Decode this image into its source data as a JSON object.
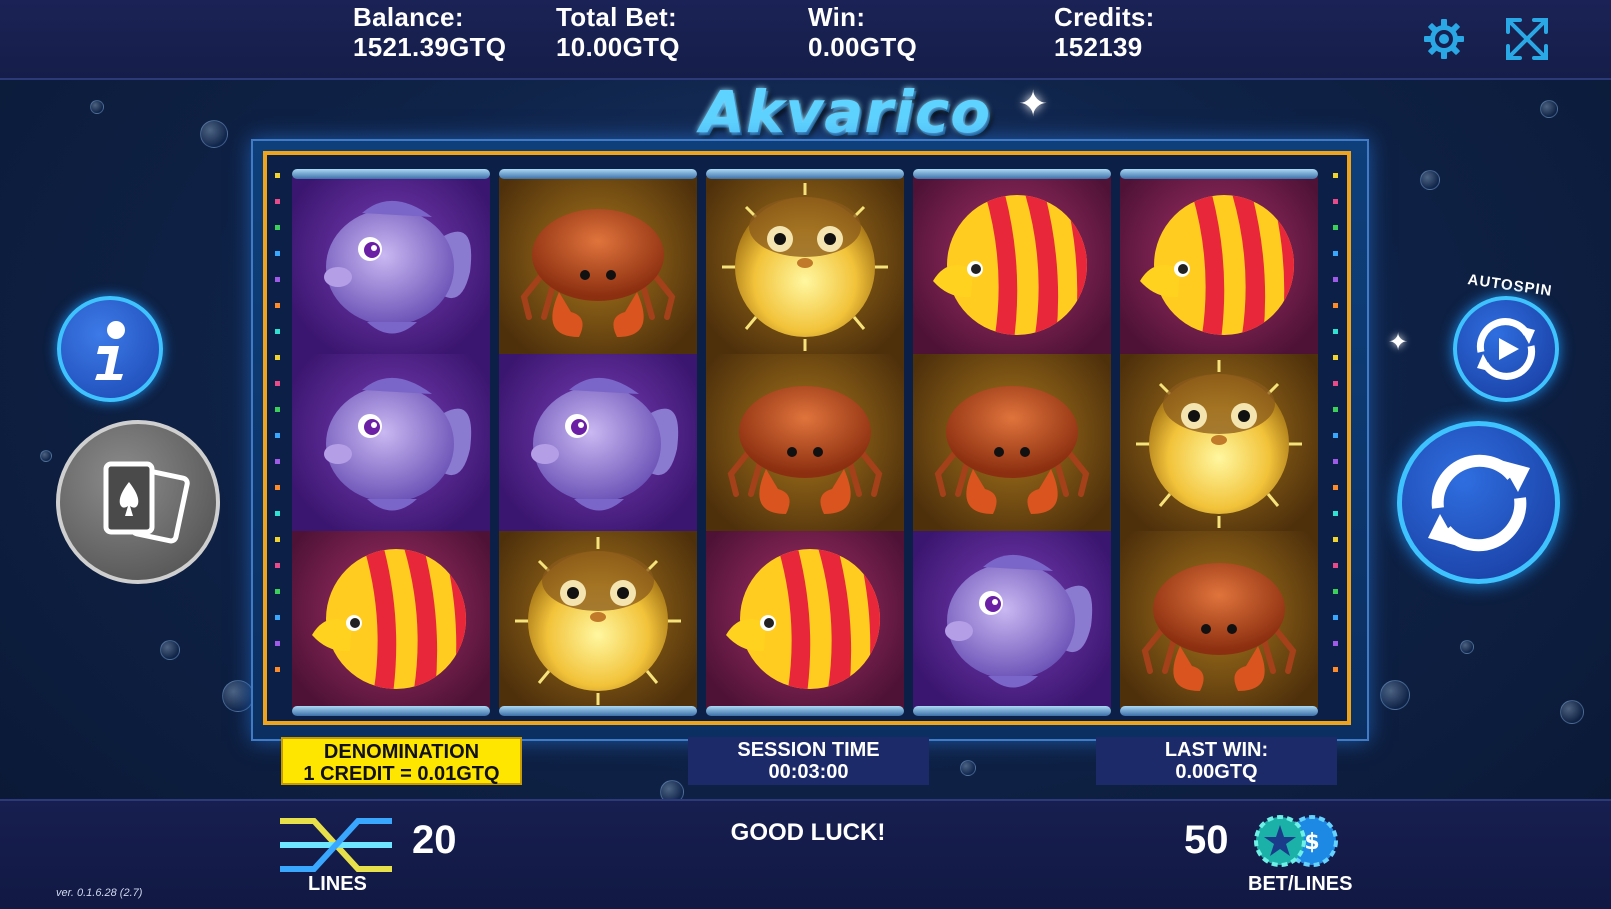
{
  "header": {
    "balance_label": "Balance:",
    "balance_value": "1521.39GTQ",
    "total_bet_label": "Total Bet:",
    "total_bet_value": "10.00GTQ",
    "win_label": "Win:",
    "win_value": "0.00GTQ",
    "credits_label": "Credits:",
    "credits_value": "152139",
    "settings_icon": "gear-icon",
    "fullscreen_icon": "expand-arrows-icon"
  },
  "game": {
    "logo_text": "Akvarico"
  },
  "reels": [
    [
      "purple-fish",
      "purple-fish",
      "striped-fish"
    ],
    [
      "crab",
      "purple-fish",
      "pufferfish"
    ],
    [
      "pufferfish",
      "crab",
      "striped-fish"
    ],
    [
      "striped-fish",
      "crab",
      "purple-fish"
    ],
    [
      "striped-fish",
      "pufferfish",
      "crab"
    ]
  ],
  "info_panels": {
    "denomination_label": "DENOMINATION",
    "denomination_value": "1 CREDIT = 0.01GTQ",
    "session_time_label": "SESSION TIME",
    "session_time_value": "00:03:00",
    "last_win_label": "LAST WIN:",
    "last_win_value": "0.00GTQ"
  },
  "controls": {
    "info_icon": "info-icon",
    "cards_icon": "gamble-cards-icon",
    "autospin_label": "AUTOSPIN",
    "autospin_icon": "autospin-icon",
    "spin_icon": "spin-arrows-icon"
  },
  "footer": {
    "lines_value": "20",
    "lines_label": "LINES",
    "message": "GOOD LUCK!",
    "bet_lines_value": "50",
    "bet_lines_label": "BET/LINES",
    "version": "ver. 0.1.6.28 (2.7)"
  },
  "colors": {
    "frame_gold": "#f0a41c",
    "denomination_bg": "#ffe600",
    "accent_cyan": "#29b6f6",
    "button_blue": "#1f56c9"
  }
}
